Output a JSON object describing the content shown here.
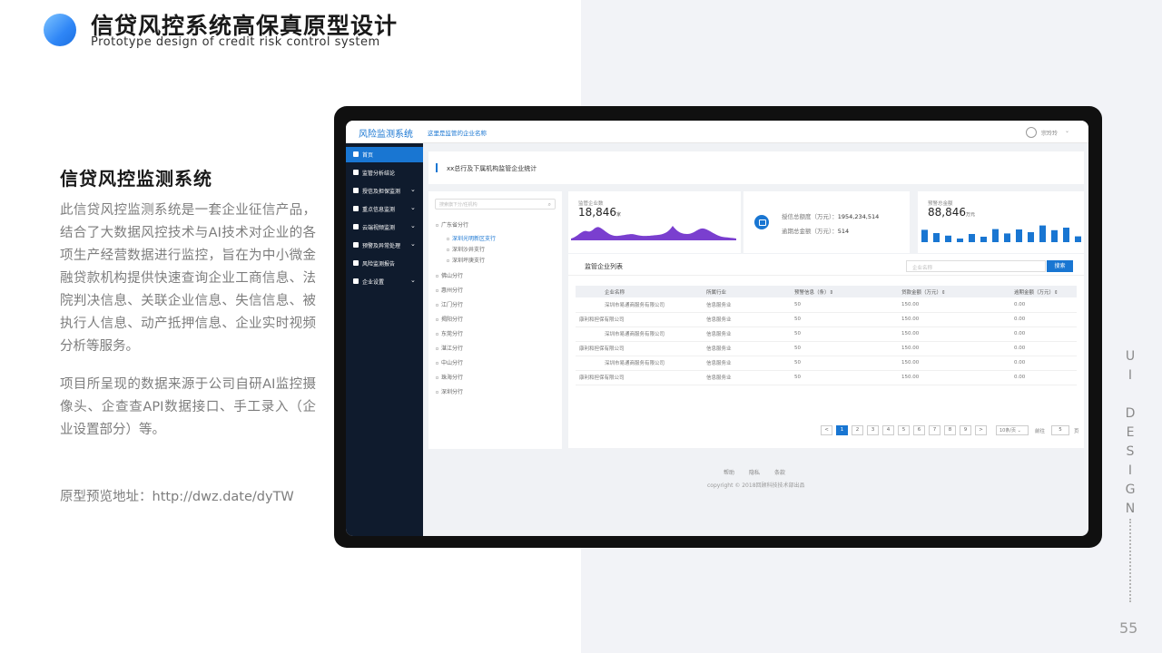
{
  "slide": {
    "title": "信贷风控系统高保真原型设计",
    "subtitle": "Prototype design of credit risk control system",
    "section_title": "信贷风控监测系统",
    "desc1": "此信贷风控监测系统是一套企业征信产品，结合了大数据风控技术与AI技术对企业的各项生产经营数据进行监控，旨在为中小微金融贷款机构提供快速查询企业工商信息、法院判决信息、关联企业信息、失信信息、被执行人信息、动产抵押信息、企业实时视频分析等服务。",
    "desc2": "项目所呈现的数据来源于公司自研AI监控摄像头、企查查API数据接口、手工录入（企业设置部分）等。",
    "preview": "原型预览地址：http://dwz.date/dyTW",
    "vertical_label": "UI DESIGN",
    "page_number": "55"
  },
  "app": {
    "name": "风险监测系统",
    "company": "这里是监管的企业名称",
    "user": "宗玲玲",
    "sidebar": [
      {
        "label": "首页",
        "active": true,
        "caret": false
      },
      {
        "label": "监管分析结论",
        "active": false,
        "caret": false
      },
      {
        "label": "授信及担保监测",
        "active": false,
        "caret": true
      },
      {
        "label": "重点信息监测",
        "active": false,
        "caret": true
      },
      {
        "label": "云端视频监测",
        "active": false,
        "caret": true
      },
      {
        "label": "预警及异常处理",
        "active": false,
        "caret": true
      },
      {
        "label": "风险监测报告",
        "active": false,
        "caret": false
      },
      {
        "label": "企业设置",
        "active": false,
        "caret": true
      }
    ],
    "breadcrumb": "xx总行及下属机构监管企业统计",
    "tree": {
      "placeholder": "搜索旗下分/任机构",
      "items": [
        {
          "label": "广东省分行",
          "level": 0,
          "selected": false
        },
        {
          "label": "深圳光明新区支行",
          "level": 1,
          "selected": true
        },
        {
          "label": "深圳沙井支行",
          "level": 1,
          "selected": false
        },
        {
          "label": "深圳坪庚支行",
          "level": 1,
          "selected": false
        },
        {
          "label": "佛山分行",
          "level": 0,
          "selected": false
        },
        {
          "label": "惠州分行",
          "level": 0,
          "selected": false
        },
        {
          "label": "江门分行",
          "level": 0,
          "selected": false
        },
        {
          "label": "揭阳分行",
          "level": 0,
          "selected": false
        },
        {
          "label": "东莞分行",
          "level": 0,
          "selected": false
        },
        {
          "label": "湛江分行",
          "level": 0,
          "selected": false
        },
        {
          "label": "中山分行",
          "level": 0,
          "selected": false
        },
        {
          "label": "珠海分行",
          "level": 0,
          "selected": false
        },
        {
          "label": "深圳分行",
          "level": 0,
          "selected": false
        }
      ]
    },
    "stat1": {
      "label": "监管企业数",
      "value": "18,846",
      "unit": "家"
    },
    "stat2": {
      "line1_label": "授信总额度（万元）：",
      "line1_value": "1954,234,514",
      "line2_label": "逾期总金额（万元）：",
      "line2_value": "514"
    },
    "stat3": {
      "label": "预警总金额",
      "value": "88,846",
      "unit": "万元",
      "bars": [
        0.68,
        0.5,
        0.36,
        0.2,
        0.45,
        0.3,
        0.72,
        0.48,
        0.7,
        0.55,
        0.92,
        0.66,
        0.8,
        0.32
      ]
    },
    "list": {
      "title": "监管企业列表",
      "search_placeholder": "企业名称",
      "search_btn": "搜索",
      "columns": [
        "企业名称",
        "所属行业",
        "预警信息（条）⇕",
        "贷款金额（万元）⇕",
        "逾期金额（万元）⇕"
      ],
      "rows": [
        [
          "深圳市易通商服务有限公司",
          "信息服务业",
          "50",
          "150.00",
          "0.00"
        ],
        [
          "康利和担保有限公司",
          "信息服务业",
          "50",
          "150.00",
          "0.00"
        ],
        [
          "深圳市易通商服务有限公司",
          "信息服务业",
          "50",
          "150.00",
          "0.00"
        ],
        [
          "康利和担保有限公司",
          "信息服务业",
          "50",
          "150.00",
          "0.00"
        ],
        [
          "深圳市易通商服务有限公司",
          "信息服务业",
          "50",
          "150.00",
          "0.00"
        ],
        [
          "康利和担保有限公司",
          "信息服务业",
          "50",
          "150.00",
          "0.00"
        ]
      ]
    },
    "pager": {
      "prev": "<",
      "next": ">",
      "pages": [
        "1",
        "2",
        "3",
        "4",
        "5",
        "6",
        "7",
        "8",
        "9"
      ],
      "size": "10条/页",
      "jump_label": "前往",
      "jump_value": "5",
      "page_suffix": "页"
    },
    "footer": {
      "links": [
        "帮助",
        "隐私",
        "条款"
      ],
      "copyright": "copyright © 2018回顾科技技术部出品"
    }
  }
}
